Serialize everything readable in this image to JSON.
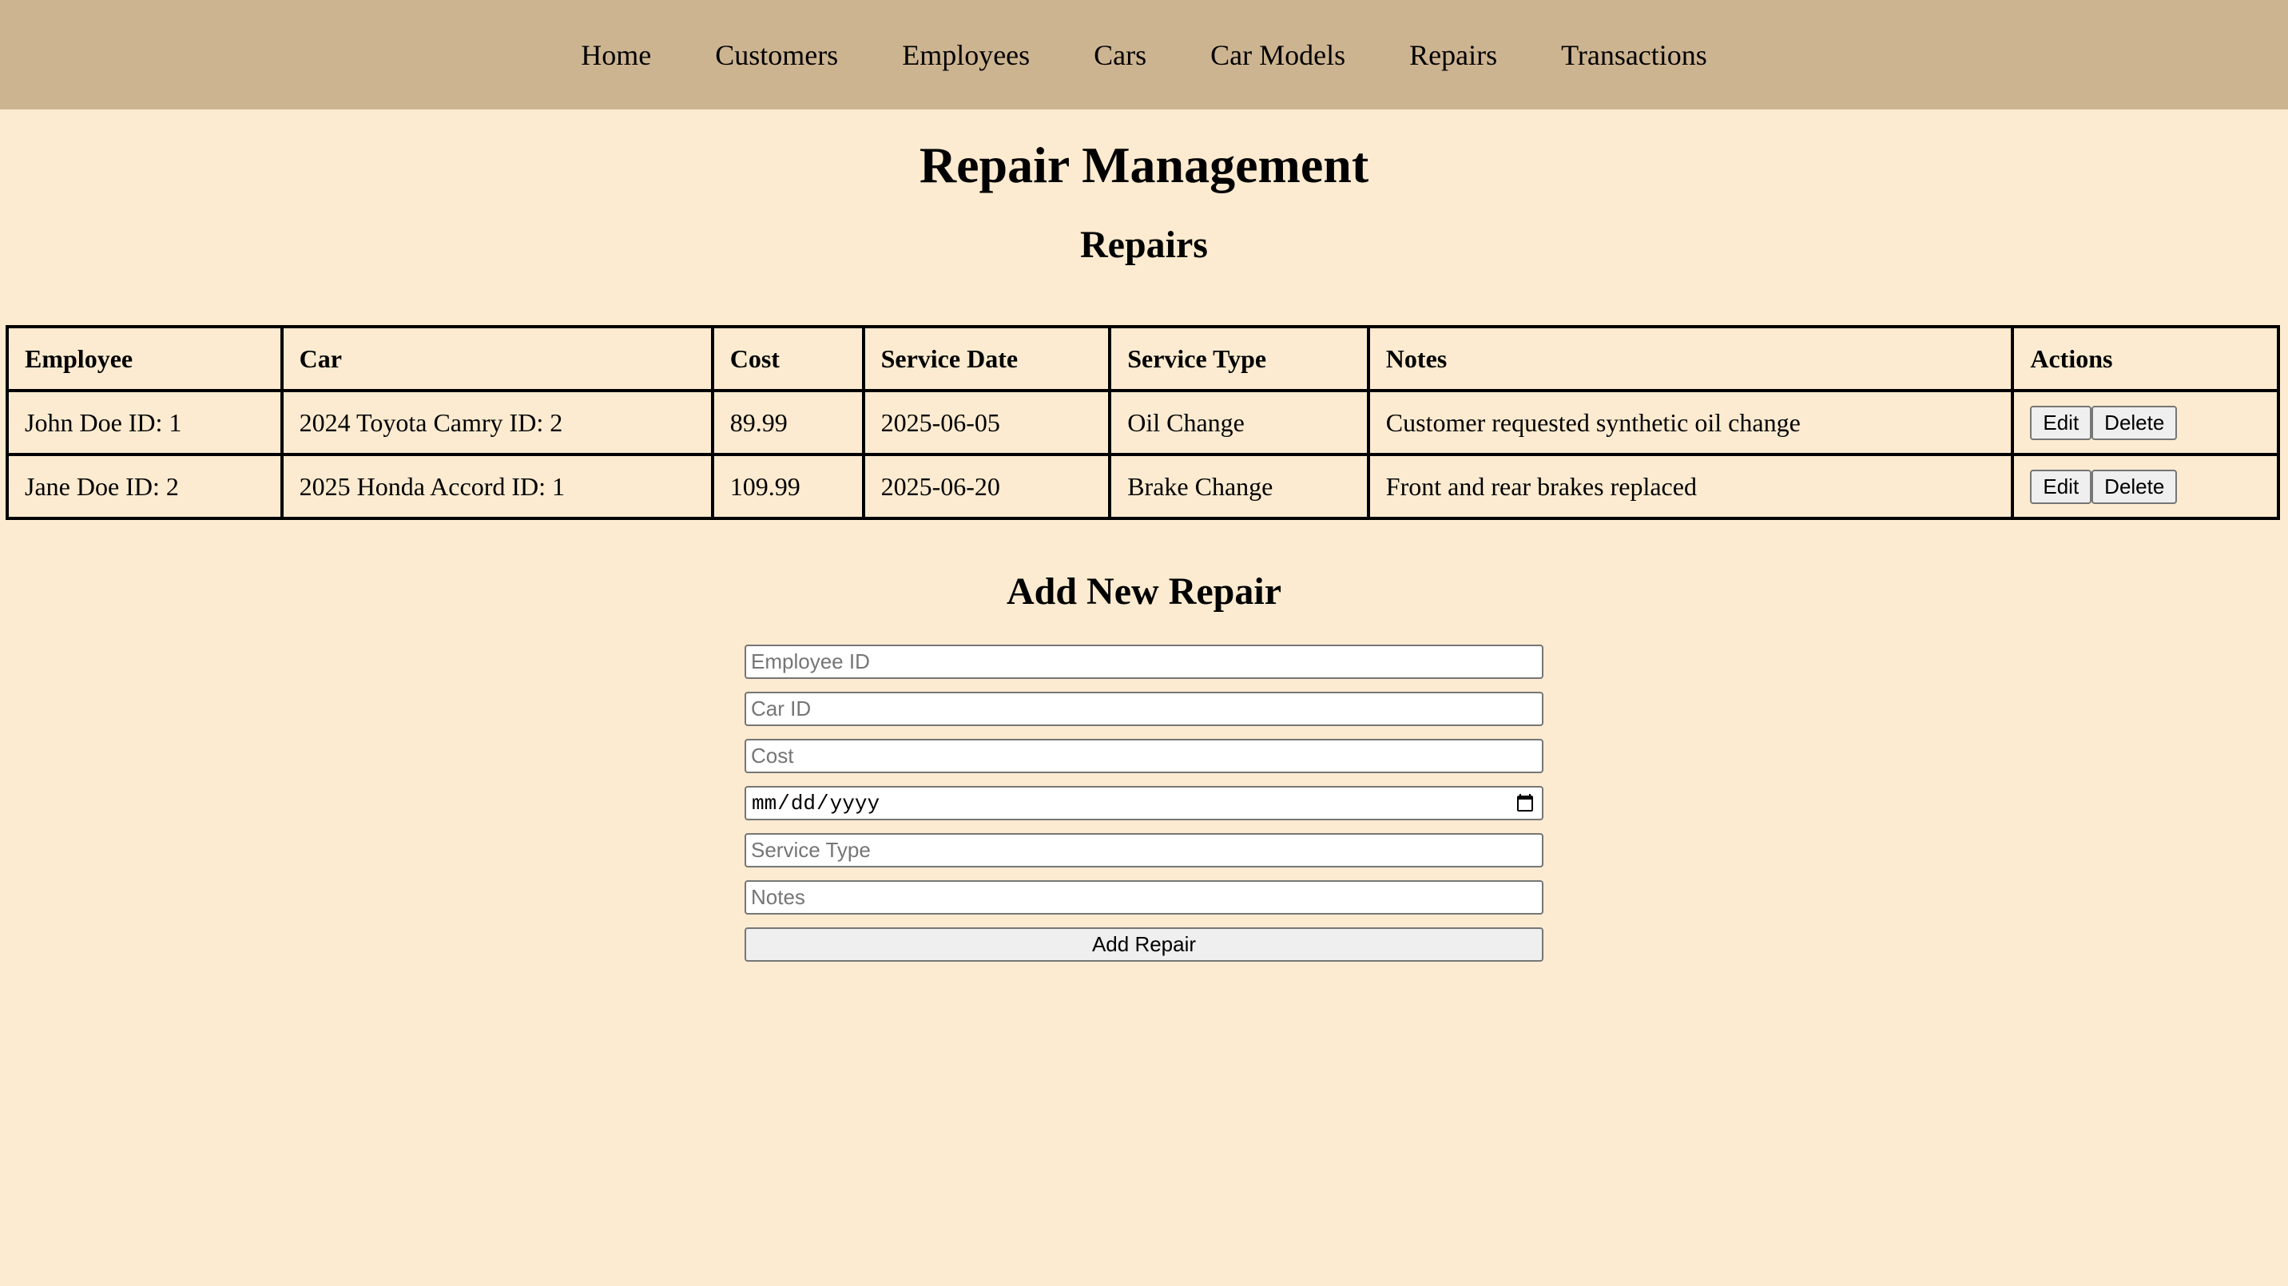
{
  "nav": {
    "items": [
      "Home",
      "Customers",
      "Employees",
      "Cars",
      "Car Models",
      "Repairs",
      "Transactions"
    ]
  },
  "page": {
    "title": "Repair Management",
    "repairs_heading": "Repairs",
    "add_heading": "Add New Repair"
  },
  "table": {
    "headers": [
      "Employee",
      "Car",
      "Cost",
      "Service Date",
      "Service Type",
      "Notes",
      "Actions"
    ],
    "rows": [
      {
        "employee": "John Doe ID: 1",
        "car": "2024 Toyota Camry ID: 2",
        "cost": "89.99",
        "date": "2025-06-05",
        "type": "Oil Change",
        "notes": "Customer requested synthetic oil change"
      },
      {
        "employee": "Jane Doe ID: 2",
        "car": "2025 Honda Accord ID: 1",
        "cost": "109.99",
        "date": "2025-06-20",
        "type": "Brake Change",
        "notes": "Front and rear brakes replaced"
      }
    ],
    "edit_label": "Edit",
    "delete_label": "Delete"
  },
  "form": {
    "employee_placeholder": "Employee ID",
    "car_placeholder": "Car ID",
    "cost_placeholder": "Cost",
    "service_type_placeholder": "Service Type",
    "notes_placeholder": "Notes",
    "submit_label": "Add Repair"
  }
}
